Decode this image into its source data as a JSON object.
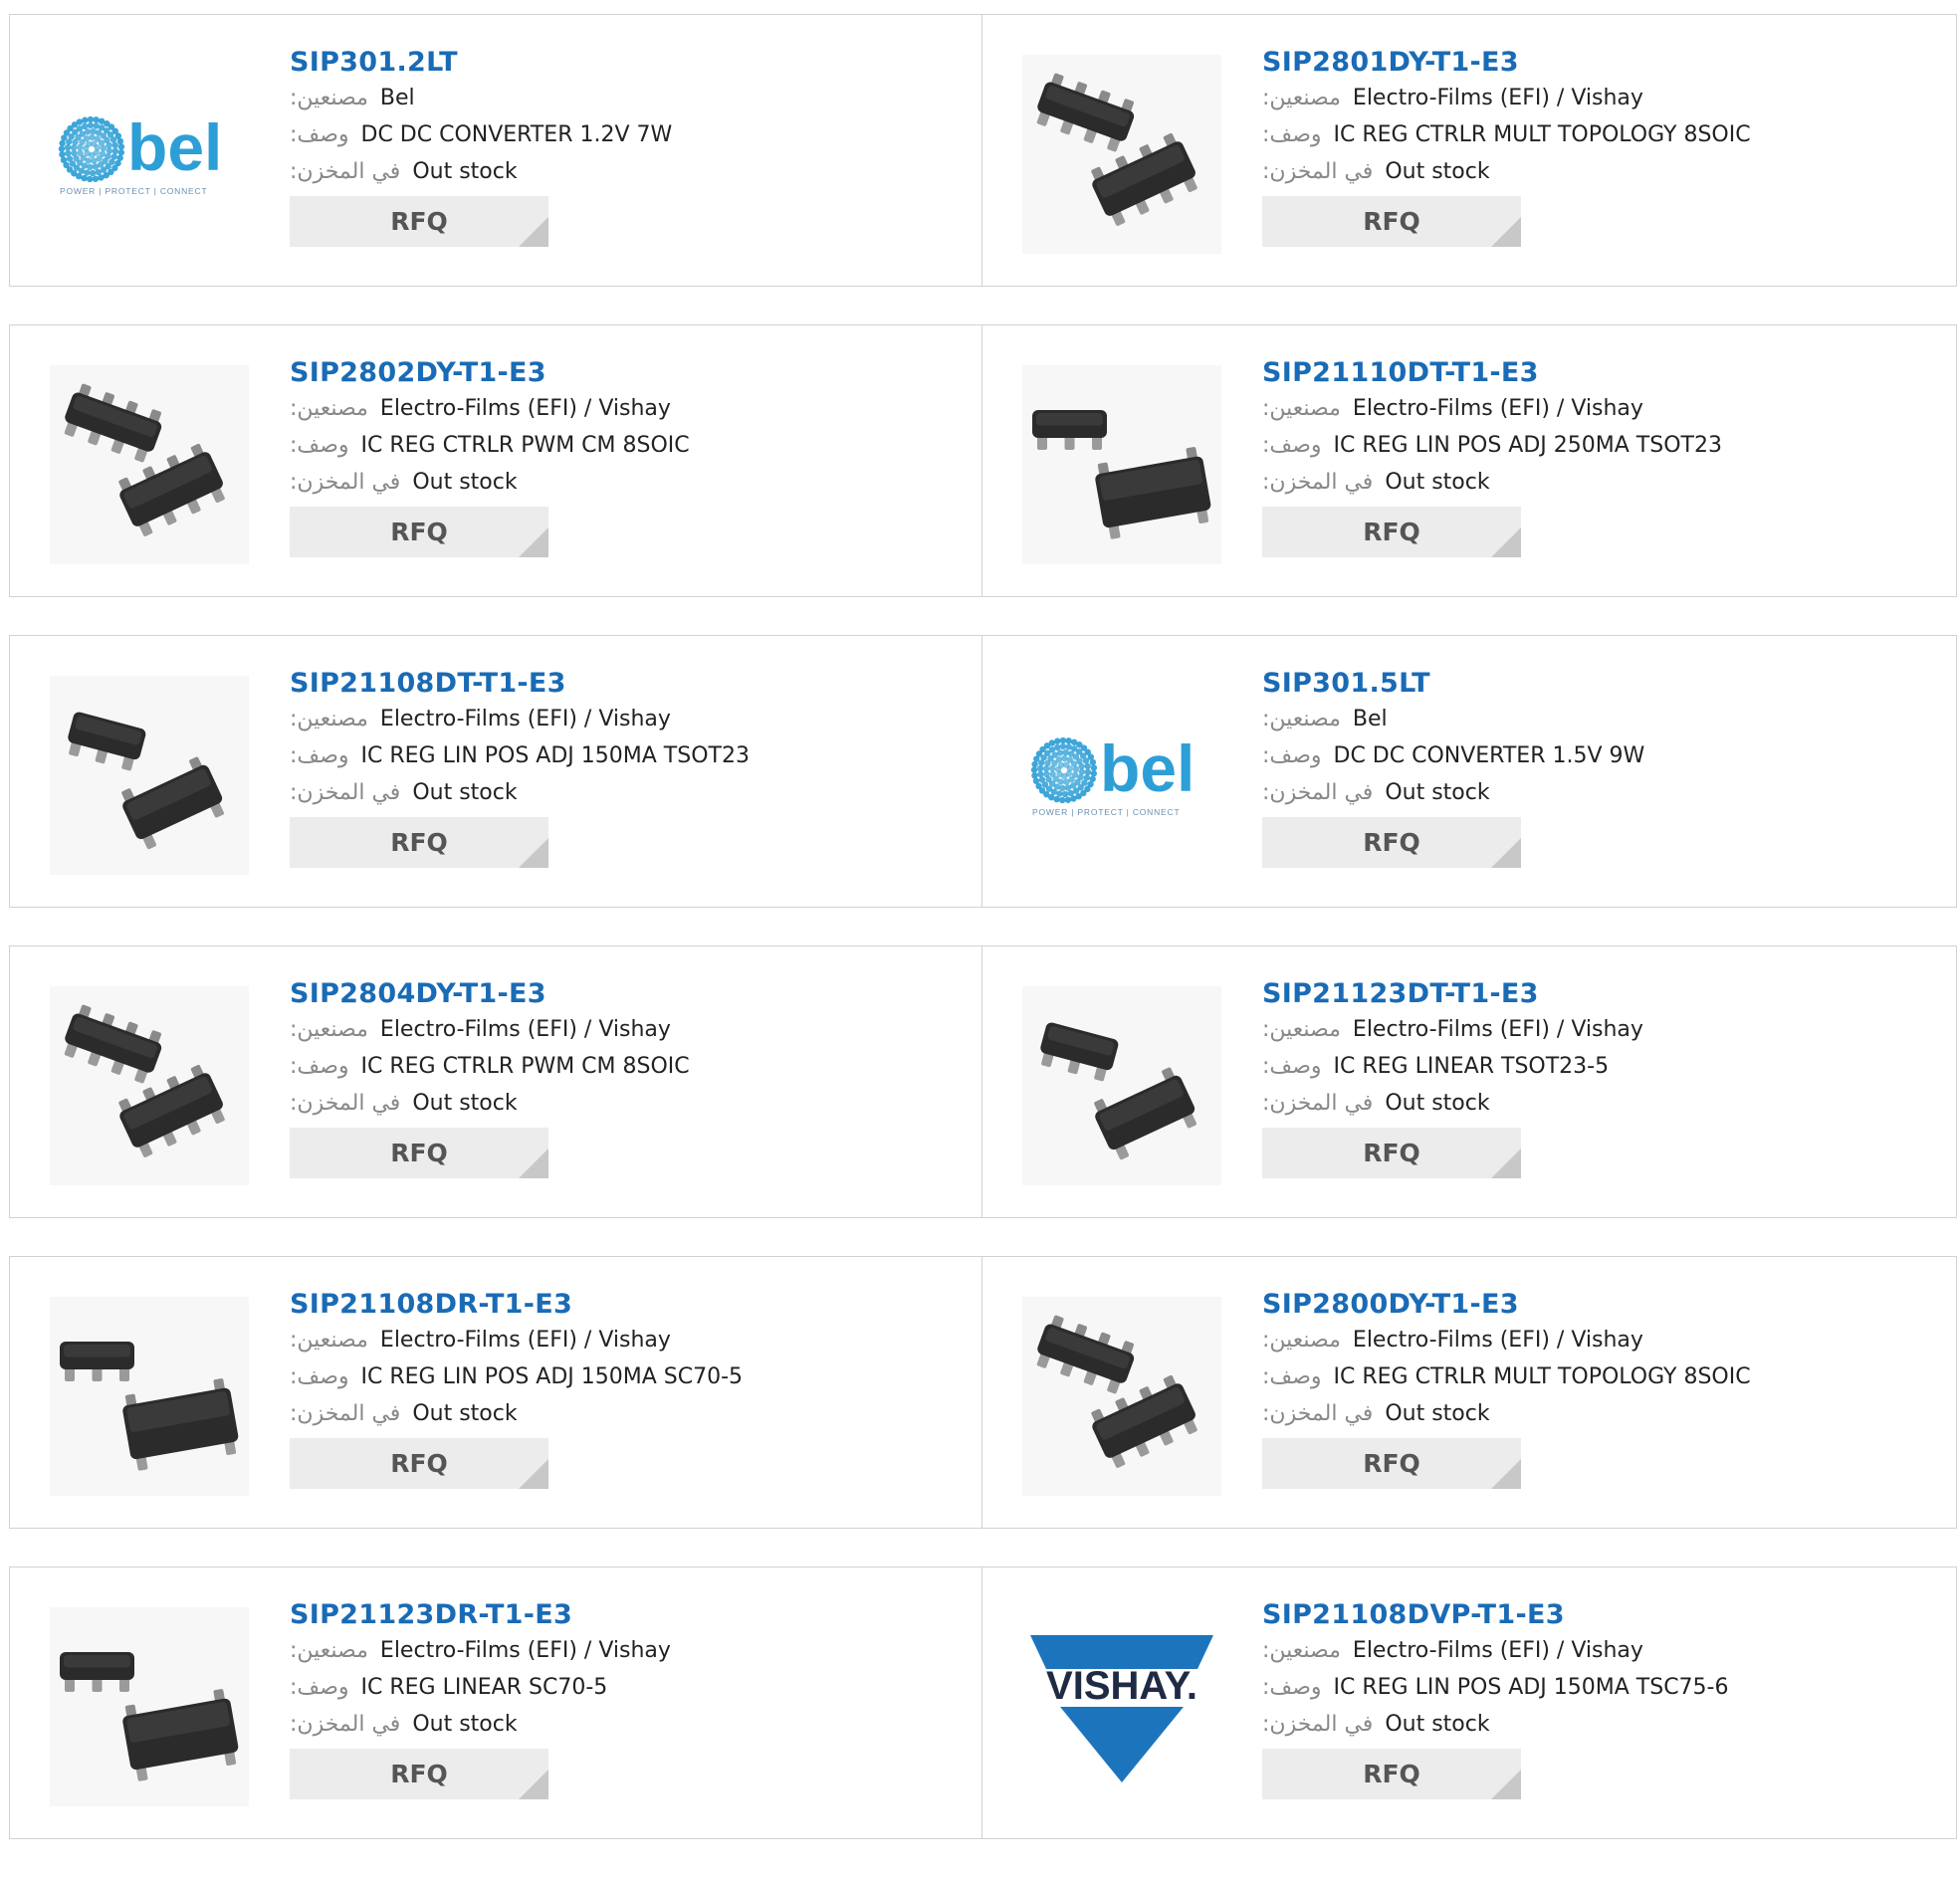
{
  "labels": {
    "manufacturer": ":مصنعين",
    "description": ":وصف",
    "stock": ":في المخزن",
    "rfq": "RFQ"
  },
  "products": [
    {
      "part": "SIP301.2LT",
      "manufacturer": "Bel",
      "description": "DC DC CONVERTER 1.2V 7W",
      "stock": "Out stock",
      "image": "bel-logo",
      "logo_tagline": "POWER | PROTECT | CONNECT"
    },
    {
      "part": "SIP2801DY-T1-E3",
      "manufacturer": "Electro-Films (EFI) / Vishay",
      "description": "IC REG CTRLR MULT TOPOLOGY 8SOIC",
      "stock": "Out stock",
      "image": "chip-soic8"
    },
    {
      "part": "SIP2802DY-T1-E3",
      "manufacturer": "Electro-Films (EFI) / Vishay",
      "description": "IC REG CTRLR PWM CM 8SOIC",
      "stock": "Out stock",
      "image": "chip-soic8"
    },
    {
      "part": "SIP21110DT-T1-E3",
      "manufacturer": "Electro-Films (EFI) / Vishay",
      "description": "IC REG LIN POS ADJ 250MA TSOT23",
      "stock": "Out stock",
      "image": "chip-sot"
    },
    {
      "part": "SIP21108DT-T1-E3",
      "manufacturer": "Electro-Films (EFI) / Vishay",
      "description": "IC REG LIN POS ADJ 150MA TSOT23",
      "stock": "Out stock",
      "image": "chip-tsot"
    },
    {
      "part": "SIP301.5LT",
      "manufacturer": "Bel",
      "description": "DC DC CONVERTER 1.5V 9W",
      "stock": "Out stock",
      "image": "bel-logo",
      "logo_tagline": "POWER | PROTECT | CONNECT"
    },
    {
      "part": "SIP2804DY-T1-E3",
      "manufacturer": "Electro-Films (EFI) / Vishay",
      "description": "IC REG CTRLR PWM CM 8SOIC",
      "stock": "Out stock",
      "image": "chip-soic8"
    },
    {
      "part": "SIP21123DT-T1-E3",
      "manufacturer": "Electro-Films (EFI) / Vishay",
      "description": "IC REG LINEAR TSOT23-5",
      "stock": "Out stock",
      "image": "chip-tsot"
    },
    {
      "part": "SIP21108DR-T1-E3",
      "manufacturer": "Electro-Films (EFI) / Vishay",
      "description": "IC REG LIN POS ADJ 150MA SC70-5",
      "stock": "Out stock",
      "image": "chip-sot"
    },
    {
      "part": "SIP2800DY-T1-E3",
      "manufacturer": "Electro-Films (EFI) / Vishay",
      "description": "IC REG CTRLR MULT TOPOLOGY 8SOIC",
      "stock": "Out stock",
      "image": "chip-soic8"
    },
    {
      "part": "SIP21123DR-T1-E3",
      "manufacturer": "Electro-Films (EFI) / Vishay",
      "description": "IC REG LINEAR SC70-5",
      "stock": "Out stock",
      "image": "chip-sot"
    },
    {
      "part": "SIP21108DVP-T1-E3",
      "manufacturer": "Electro-Films (EFI) / Vishay",
      "description": "IC REG LIN POS ADJ 150MA TSC75-6",
      "stock": "Out stock",
      "image": "vishay-logo",
      "logo_text": "VISHAY."
    }
  ],
  "colors": {
    "part_link": "#1a6bb5",
    "bel_blue": "#2d9fd6",
    "vishay_blue": "#1c75bc"
  }
}
